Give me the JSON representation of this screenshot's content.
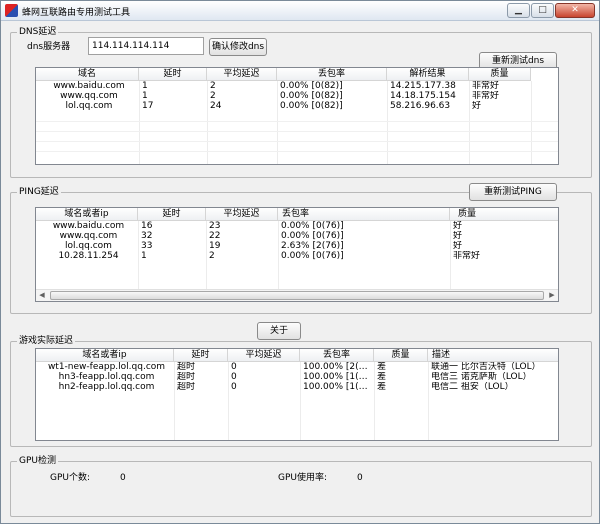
{
  "window": {
    "title": "蜂网互联路由专用测试工具",
    "min_glyph": "▁",
    "max_glyph": "□",
    "close_glyph": "✕"
  },
  "dns": {
    "group_label": "DNS延迟",
    "server_label": "dns服务器",
    "server_value": "114.114.114.114",
    "confirm_button": "确认修改dns",
    "retest_button": "重新测试dns",
    "columns": [
      "域名",
      "延时",
      "平均延迟",
      "丢包率",
      "解析结果",
      "质量"
    ],
    "rows": [
      [
        "www.baidu.com",
        "1",
        "2",
        "0.00%   [0(82)]",
        "14.215.177.38",
        "非常好"
      ],
      [
        "www.qq.com",
        "1",
        "2",
        "0.00%   [0(82)]",
        "14.18.175.154",
        "非常好"
      ],
      [
        "lol.qq.com",
        "17",
        "24",
        "0.00%   [0(82)]",
        "58.216.96.63",
        "好"
      ]
    ]
  },
  "ping": {
    "group_label": "PING延迟",
    "retest_button": "重新测试PING",
    "columns": [
      "域名或者ip",
      "延时",
      "平均延迟",
      "丢包率",
      "质量"
    ],
    "rows": [
      [
        "www.baidu.com",
        "16",
        "23",
        "0.00%   [0(76)]",
        "好"
      ],
      [
        "www.qq.com",
        "32",
        "22",
        "0.00%   [0(76)]",
        "好"
      ],
      [
        "lol.qq.com",
        "33",
        "19",
        "2.63%   [2(76)]",
        "好"
      ],
      [
        "10.28.11.254",
        "1",
        "2",
        "0.00%   [0(76)]",
        "非常好"
      ]
    ],
    "scroll_left": "◀",
    "scroll_right": "▶"
  },
  "about_button": "关于",
  "game": {
    "group_label": "游戏实际延迟",
    "columns": [
      "域名或者ip",
      "延时",
      "平均延迟",
      "丢包率",
      "质量",
      "描述"
    ],
    "rows": [
      [
        "wt1-new-feapp.lol.qq.com",
        "超时",
        "0",
        "100.00%   [2(…",
        "差",
        "联通一 比尔吉沃特（LOL）"
      ],
      [
        "hn3-feapp.lol.qq.com",
        "超时",
        "0",
        "100.00%   [1(…",
        "差",
        "电信三 诺克萨斯（LOL）"
      ],
      [
        "hn2-feapp.lol.qq.com",
        "超时",
        "0",
        "100.00%   [1(…",
        "差",
        "电信二 祖安（LOL）"
      ]
    ]
  },
  "gpu": {
    "group_label": "GPU检测",
    "count_label": "GPU个数:",
    "count_value": "0",
    "usage_label": "GPU使用率:",
    "usage_value": "0"
  }
}
